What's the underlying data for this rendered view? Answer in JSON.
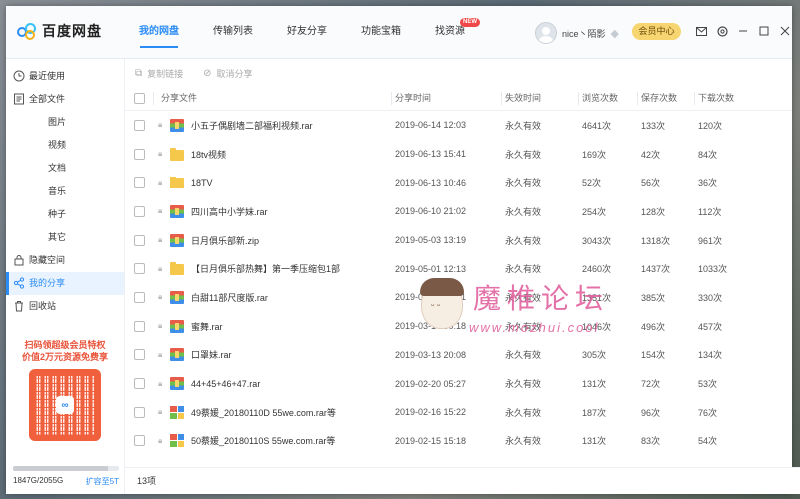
{
  "app": {
    "name": "百度网盘",
    "brand_color": "#2b8cf5"
  },
  "nav": {
    "tabs": [
      {
        "label": "我的网盘",
        "active": true
      },
      {
        "label": "传输列表"
      },
      {
        "label": "好友分享"
      },
      {
        "label": "功能宝箱"
      },
      {
        "label": "找资源",
        "badge": "NEW"
      }
    ]
  },
  "user": {
    "name": "nice丶陌影",
    "vip_button": "会员中心"
  },
  "header_icons": [
    "mail-icon",
    "settings-icon",
    "minimize-icon",
    "maximize-icon",
    "close-icon"
  ],
  "sidebar": {
    "items": [
      {
        "label": "最近使用",
        "icon": "clock-icon"
      },
      {
        "label": "全部文件",
        "icon": "file-icon"
      },
      {
        "label": "图片",
        "sub": true
      },
      {
        "label": "视频",
        "sub": true
      },
      {
        "label": "文档",
        "sub": true
      },
      {
        "label": "音乐",
        "sub": true
      },
      {
        "label": "种子",
        "sub": true
      },
      {
        "label": "其它",
        "sub": true
      },
      {
        "label": "隐藏空间",
        "icon": "lock-icon"
      },
      {
        "label": "我的分享",
        "icon": "share-icon",
        "active": true
      },
      {
        "label": "回收站",
        "icon": "trash-icon"
      }
    ],
    "promo": {
      "line1": "扫码领超级会员特权",
      "line2": "价值2万元资源免费享"
    },
    "storage": {
      "used": "1847G/2055G",
      "expand": "扩容至5T",
      "fraction": 0.899
    }
  },
  "toolbar": {
    "copy_link": "复制链接",
    "cancel_share": "取消分享"
  },
  "table": {
    "headers": [
      "分享文件",
      "分享时间",
      "失效时间",
      "浏览次数",
      "保存次数",
      "下载次数"
    ],
    "rows": [
      {
        "icon": "rar",
        "name": "小五子偶剧墙二部福利视频.rar",
        "time": "2019-06-14 12:03",
        "expire": "永久有效",
        "views": "4641次",
        "saves": "133次",
        "downloads": "120次"
      },
      {
        "icon": "folder",
        "name": "18tv视频",
        "time": "2019-06-13 15:41",
        "expire": "永久有效",
        "views": "169次",
        "saves": "42次",
        "downloads": "84次"
      },
      {
        "icon": "folder",
        "name": "18TV",
        "time": "2019-06-13 10:46",
        "expire": "永久有效",
        "views": "52次",
        "saves": "56次",
        "downloads": "36次"
      },
      {
        "icon": "rar",
        "name": "四川高中小学妹.rar",
        "time": "2019-06-10 21:02",
        "expire": "永久有效",
        "views": "254次",
        "saves": "128次",
        "downloads": "112次"
      },
      {
        "icon": "rar",
        "name": "日月俱乐部新.zip",
        "time": "2019-05-03 13:19",
        "expire": "永久有效",
        "views": "3043次",
        "saves": "1318次",
        "downloads": "961次"
      },
      {
        "icon": "folder",
        "name": "【日月俱乐部热舞】第一季压缩包1部",
        "time": "2019-05-01 12:13",
        "expire": "永久有效",
        "views": "2460次",
        "saves": "1437次",
        "downloads": "1033次"
      },
      {
        "icon": "rar",
        "name": "白甜11部尺度版.rar",
        "time": "2019-04-13 16:01",
        "expire": "永久有效",
        "views": "1351次",
        "saves": "385次",
        "downloads": "330次"
      },
      {
        "icon": "rar",
        "name": "蜜舞.rar",
        "time": "2019-03-14 00:18",
        "expire": "永久有效",
        "views": "1046次",
        "saves": "496次",
        "downloads": "457次"
      },
      {
        "icon": "rar",
        "name": "口罩妹.rar",
        "time": "2019-03-13 20:08",
        "expire": "永久有效",
        "views": "305次",
        "saves": "154次",
        "downloads": "134次"
      },
      {
        "icon": "rar",
        "name": "44+45+46+47.rar",
        "time": "2019-02-20 05:27",
        "expire": "永久有效",
        "views": "131次",
        "saves": "72次",
        "downloads": "53次"
      },
      {
        "icon": "multi",
        "name": "49蔡媛_20180110D 55we.com.rar等",
        "time": "2019-02-16 15:22",
        "expire": "永久有效",
        "views": "187次",
        "saves": "96次",
        "downloads": "76次"
      },
      {
        "icon": "multi",
        "name": "50蔡媛_20180110S 55we.com.rar等",
        "time": "2019-02-15 15:18",
        "expire": "永久有效",
        "views": "131次",
        "saves": "83次",
        "downloads": "54次"
      }
    ]
  },
  "footer": {
    "count": "13项"
  },
  "watermark": {
    "title": "魔椎论坛",
    "url": "www.mozhui.cool"
  }
}
